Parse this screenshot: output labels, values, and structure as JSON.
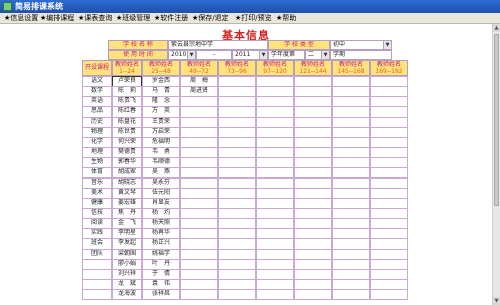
{
  "window": {
    "title": "简易排课系统"
  },
  "menu": [
    "★信息设置",
    "★编排课程",
    "★课表查询",
    "★班级管理",
    "★软件注册",
    "★保存/退定",
    "★打印/预览",
    "★帮助"
  ],
  "page_title": "基本信息",
  "school": {
    "name_label": "学 校 名 称",
    "name_value": "紫云县宗地中学",
    "type_label": "学 校 类 型",
    "type_value": "初中"
  },
  "usage": {
    "label": "使 用 时 间",
    "year_start": "2010",
    "dash": "-",
    "year_end": "2011",
    "term_label": "学年度第",
    "term_value": "二",
    "term_suffix": "学期"
  },
  "table": {
    "headers": [
      {
        "title": "开设课程",
        "range": ""
      },
      {
        "title": "教师姓名",
        "range": "1--24"
      },
      {
        "title": "教师姓名",
        "range": "25--48"
      },
      {
        "title": "教师姓名",
        "range": "49--72"
      },
      {
        "title": "教师姓名",
        "range": "73--96"
      },
      {
        "title": "教师姓名",
        "range": "97--120"
      },
      {
        "title": "教师姓名",
        "range": "121--144"
      },
      {
        "title": "教师姓名",
        "range": "145--168"
      },
      {
        "title": "教师姓名",
        "range": "169--192"
      }
    ],
    "rows": [
      [
        "语文",
        "卢荣良",
        "罗金西",
        "周　梅",
        "",
        "",
        "",
        "",
        ""
      ],
      [
        "数学",
        "陈　莉",
        "马　青",
        "周进贤",
        "",
        "",
        "",
        "",
        ""
      ],
      [
        "英语",
        "陈贵飞",
        "隆　念",
        "",
        "",
        "",
        "",
        "",
        ""
      ],
      [
        "思品",
        "陈红春",
        "万　英",
        "",
        "",
        "",
        "",
        "",
        ""
      ],
      [
        "历史",
        "陈盘花",
        "王贵荣",
        "",
        "",
        "",
        "",
        "",
        ""
      ],
      [
        "物理",
        "陈世贵",
        "万启荣",
        "",
        "",
        "",
        "",
        "",
        ""
      ],
      [
        "化学",
        "何兴荣",
        "危福明",
        "",
        "",
        "",
        "",
        "",
        ""
      ],
      [
        "地理",
        "樊德贵",
        "韦　勇",
        "",
        "",
        "",
        "",
        "",
        ""
      ],
      [
        "生物",
        "郭春华",
        "韦顺德",
        "",
        "",
        "",
        "",
        "",
        ""
      ],
      [
        "体育",
        "胡成家",
        "吴　燕",
        "",
        "",
        "",
        "",
        "",
        ""
      ],
      [
        "音乐",
        "胡晓志",
        "吴永芬",
        "",
        "",
        "",
        "",
        "",
        ""
      ],
      [
        "美术",
        "黄文琴",
        "伍元阳",
        "",
        "",
        "",
        "",
        "",
        ""
      ],
      [
        "健康",
        "姜宏雄",
        "肖显友",
        "",
        "",
        "",
        "",
        "",
        ""
      ],
      [
        "信技",
        "焦　丹",
        "杨　灼",
        "",
        "",
        "",
        "",
        "",
        ""
      ],
      [
        "阅读",
        "金　飞",
        "杨天照",
        "",
        "",
        "",
        "",
        "",
        ""
      ],
      [
        "实践",
        "李明星",
        "杨再华",
        "",
        "",
        "",
        "",
        "",
        ""
      ],
      [
        "班会",
        "李发起",
        "杨正兴",
        "",
        "",
        "",
        "",
        "",
        ""
      ],
      [
        "团队",
        "梁朝国",
        "姚福学",
        "",
        "",
        "",
        "",
        "",
        ""
      ],
      [
        "",
        "廖小娟",
        "叶　丹",
        "",
        "",
        "",
        "",
        "",
        ""
      ],
      [
        "",
        "刘兴祥",
        "于　倩",
        "",
        "",
        "",
        "",
        "",
        ""
      ],
      [
        "",
        "龙　斌",
        "袁　伟",
        "",
        "",
        "",
        "",
        "",
        ""
      ],
      [
        "",
        "龙海波",
        "张祥昌",
        "",
        "",
        "",
        "",
        "",
        ""
      ]
    ]
  }
}
